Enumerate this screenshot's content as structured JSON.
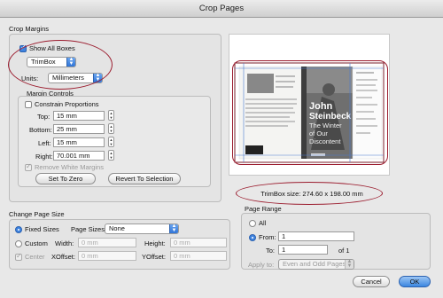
{
  "window": {
    "title": "Crop Pages"
  },
  "crop_margins": {
    "title": "Crop Margins",
    "show_all_boxes_label": "Show All Boxes",
    "box_select": "TrimBox",
    "units_label": "Units:",
    "units_select": "Millimeters"
  },
  "margin_controls": {
    "title": "Margin Controls",
    "constrain_label": "Constrain Proportions",
    "top_label": "Top:",
    "top_value": "15 mm",
    "bottom_label": "Bottom:",
    "bottom_value": "25 mm",
    "left_label": "Left:",
    "left_value": "15 mm",
    "right_label": "Right:",
    "right_value": "70.001 mm",
    "remove_white_label": "Remove White Margins",
    "set_to_zero": "Set To Zero",
    "revert": "Revert To Selection"
  },
  "preview": {
    "book_author_1": "John",
    "book_author_2": "Steinbeck",
    "book_title_1": "The Winter",
    "book_title_2": "of Our",
    "book_title_3": "Discontent",
    "trimbox_size": "TrimBox size: 274.60 x 198.00 mm"
  },
  "change_page_size": {
    "title": "Change Page Size",
    "fixed_label": "Fixed Sizes",
    "page_sizes_label": "Page Sizes:",
    "page_sizes_select": "None",
    "custom_label": "Custom",
    "width_label": "Width:",
    "width_value": "0 mm",
    "height_label": "Height:",
    "height_value": "0 mm",
    "center_label": "Center",
    "xoffset_label": "XOffset:",
    "xoffset_value": "0 mm",
    "yoffset_label": "YOffset:",
    "yoffset_value": "0 mm"
  },
  "page_range": {
    "title": "Page Range",
    "all_label": "All",
    "from_label": "From:",
    "from_value": "1",
    "to_label": "To:",
    "to_value": "1",
    "of_label": "of 1",
    "apply_label": "Apply to:",
    "apply_select": "Even and Odd Pages"
  },
  "buttons": {
    "cancel": "Cancel",
    "ok": "OK"
  },
  "colors": {
    "accent": "#3f84e0",
    "annotation": "#9b1c2e"
  }
}
